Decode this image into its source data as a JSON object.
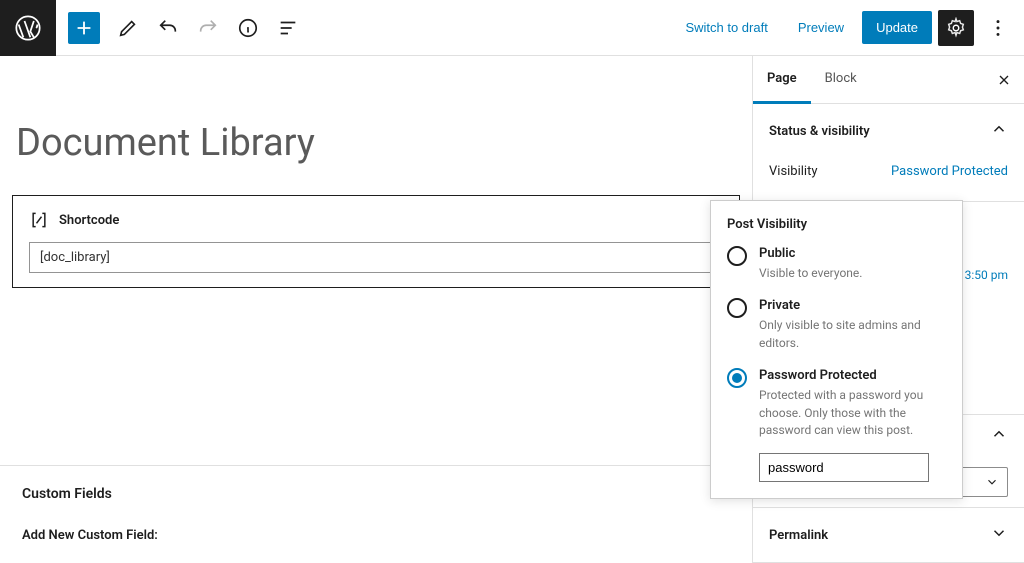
{
  "topbar": {
    "switch_to_draft": "Switch to draft",
    "preview": "Preview",
    "update": "Update"
  },
  "editor": {
    "title": "Document Library",
    "shortcode_block": {
      "label": "Shortcode",
      "value": "[doc_library]"
    },
    "custom_fields": {
      "title": "Custom Fields",
      "add_label": "Add New Custom Field:"
    }
  },
  "sidebar": {
    "tabs": {
      "page": "Page",
      "block": "Block"
    },
    "status": {
      "title": "Status & visibility",
      "visibility_label": "Visibility",
      "visibility_value": "Password Protected",
      "publish_time_peek": "3:50 pm"
    },
    "permalink": {
      "title": "Permalink"
    }
  },
  "popover": {
    "title": "Post Visibility",
    "options": [
      {
        "label": "Public",
        "desc": "Visible to everyone."
      },
      {
        "label": "Private",
        "desc": "Only visible to site admins and editors."
      },
      {
        "label": "Password Protected",
        "desc": "Protected with a password you choose. Only those with the password can view this post."
      }
    ],
    "password_value": "password"
  }
}
